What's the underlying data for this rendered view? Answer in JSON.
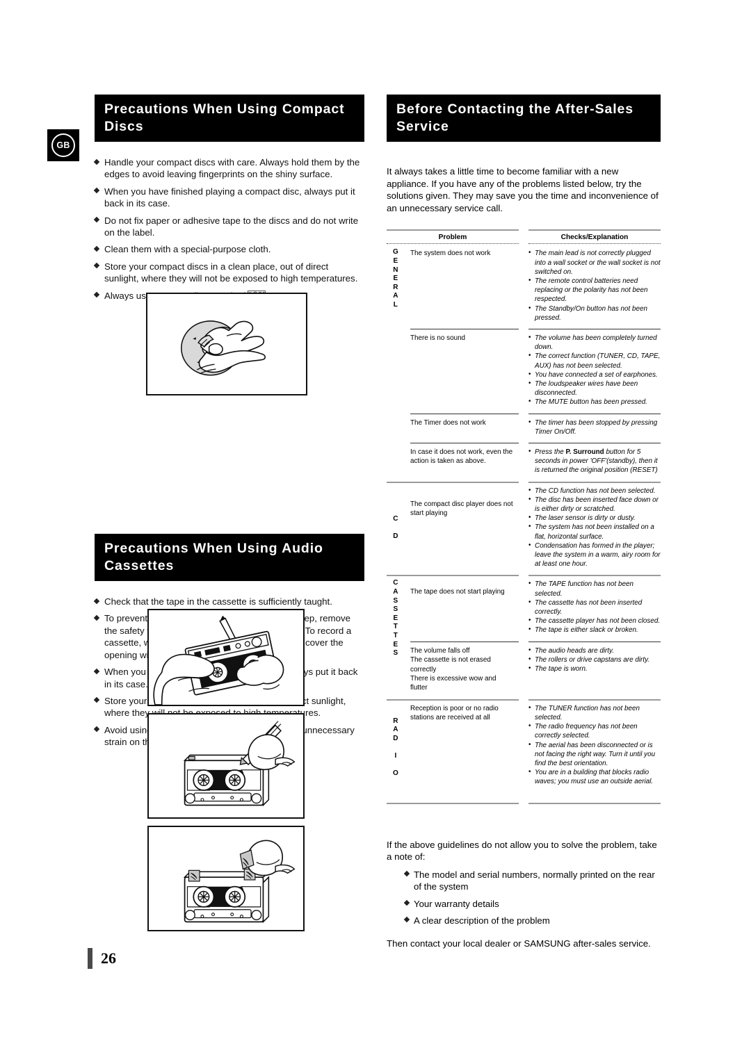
{
  "page": {
    "number": "26",
    "language_badge": "GB"
  },
  "left_column": {
    "cd_section": {
      "heading": "Precautions When Using Compact Discs",
      "bullets": [
        "Handle your compact discs with care. Always hold them by the edges to avoid leaving fingerprints on the shiny surface.",
        "When you have finished playing a compact disc, always put it back in its case.",
        "Do not fix paper or adhesive tape to the discs and do not write on the label.",
        "Clean them with a special-purpose cloth.",
        "Store your compact discs in a clean place, out of direct sunlight, where they will not be exposed to high temperatures."
      ],
      "last_bullet_prefix": "Always use compact discs marked",
      "last_bullet_suffix": ".",
      "logo_label": "compact-disc-digital-audio-logo",
      "illustration_caption": "hands-cleaning-compact-disc-illustration"
    },
    "cassette_section": {
      "heading": "Precautions When Using Audio Cassettes",
      "bullets": [
        "Check that the tape in the cassette is sufficiently taught.",
        "To prevent erasing a cassette that you wish to keep, remove the safety tab on the upper edge of the cassette. To record a cassette, where  the tab has been broken, simply cover the opening with adhesive tape.",
        "When you have finished playing a cassette, always put it back in its case.",
        "Store your cassettes in a clean place, out of direct sunlight, where they will not be exposed to high temperatures.",
        "Avoid using 120-minute cassettes as they place unnecessary strain on the tape mechanism."
      ],
      "illustrations": [
        "hands-tightening-cassette-tape-illustration",
        "breaking-cassette-safety-tab-illustration",
        "taping-over-cassette-tab-opening-illustration"
      ]
    }
  },
  "right_column": {
    "heading": "Before Contacting the After-Sales Service",
    "intro": "It always takes a little time to become familiar with a new appliance. If you have any of the problems listed below, try the solutions given. They may save you the time and inconvenience of an unnecessary service call.",
    "table": {
      "headers": {
        "problem": "Problem",
        "checks": "Checks/Explanation"
      },
      "groups": [
        {
          "label": "GENERAL",
          "rows": [
            {
              "problem": "The system does not work",
              "checks": [
                "The main lead is not correctly plugged into a wall socket or the wall socket is not switched on.",
                "The remote control batteries need replacing or the polarity has not been respected.",
                "The  Standby/On button has not been pressed."
              ]
            },
            {
              "problem": "There is no sound",
              "checks": [
                "The volume has been completely turned down.",
                "The correct function (TUNER, CD, TAPE, AUX) has not been selected.",
                "You have connected a set of earphones.",
                "The loudspeaker wires have been disconnected.",
                "The MUTE button has been pressed."
              ]
            },
            {
              "problem": "The Timer does not work",
              "checks": [
                "The timer has been stopped by pressing Timer On/Off."
              ]
            },
            {
              "problem": "In case it does not work, even the action is taken as above.",
              "checks_rich": {
                "before": "Press the ",
                "bold": "P. Surround",
                "after": " button for 5 seconds in power 'OFF'(standby), then it is returned the original position (RESET)"
              }
            }
          ]
        },
        {
          "label": "CD",
          "rows": [
            {
              "problem": "The compact disc player does not start playing",
              "checks": [
                "The CD function has not been selected.",
                "The disc has been inserted face down or is either dirty or scratched.",
                "The laser sensor is dirty or dusty.",
                "The system has not been installed on a flat, horizontal surface.",
                "Condensation has formed in the player; leave the system in a warm, airy room for at least one hour."
              ]
            }
          ]
        },
        {
          "label": "CASSETTES",
          "rows": [
            {
              "problem": "The tape does not start playing",
              "checks": [
                "The TAPE function has not been selected.",
                "The cassette has not been inserted correctly.",
                "The cassette player has not been closed.",
                "The tape is either slack or broken."
              ]
            },
            {
              "problem_lines": [
                "The volume falls off",
                "The cassette is not erased correctly",
                "There is excessive wow and flutter"
              ],
              "checks": [
                "The audio heads are dirty.",
                "The rollers or drive capstans are dirty.",
                "The tape is worn."
              ]
            }
          ]
        },
        {
          "label": "RADIO",
          "rows": [
            {
              "problem": "Reception is poor or no radio stations are received at all",
              "checks": [
                "The TUNER function has not been selected.",
                "The radio frequency has not been correctly selected.",
                "The aerial has been disconnected or is not facing the right way. Turn it until you find the best orientation.",
                "You are in a building that blocks radio waves; you must use an outside aerial."
              ]
            }
          ]
        }
      ]
    },
    "closing": {
      "intro": "If the above guidelines do not allow you to solve the problem, take a note of:",
      "items": [
        "The model and serial numbers, normally printed on the rear of the system",
        "Your warranty details",
        "A clear description of the problem"
      ],
      "tail": "Then contact your local dealer or SAMSUNG after-sales service."
    }
  },
  "colors": {
    "ink": "#000000",
    "paper": "#ffffff",
    "rule_grey": "#9a9a9a",
    "page_bar": "#4a4a4a"
  }
}
